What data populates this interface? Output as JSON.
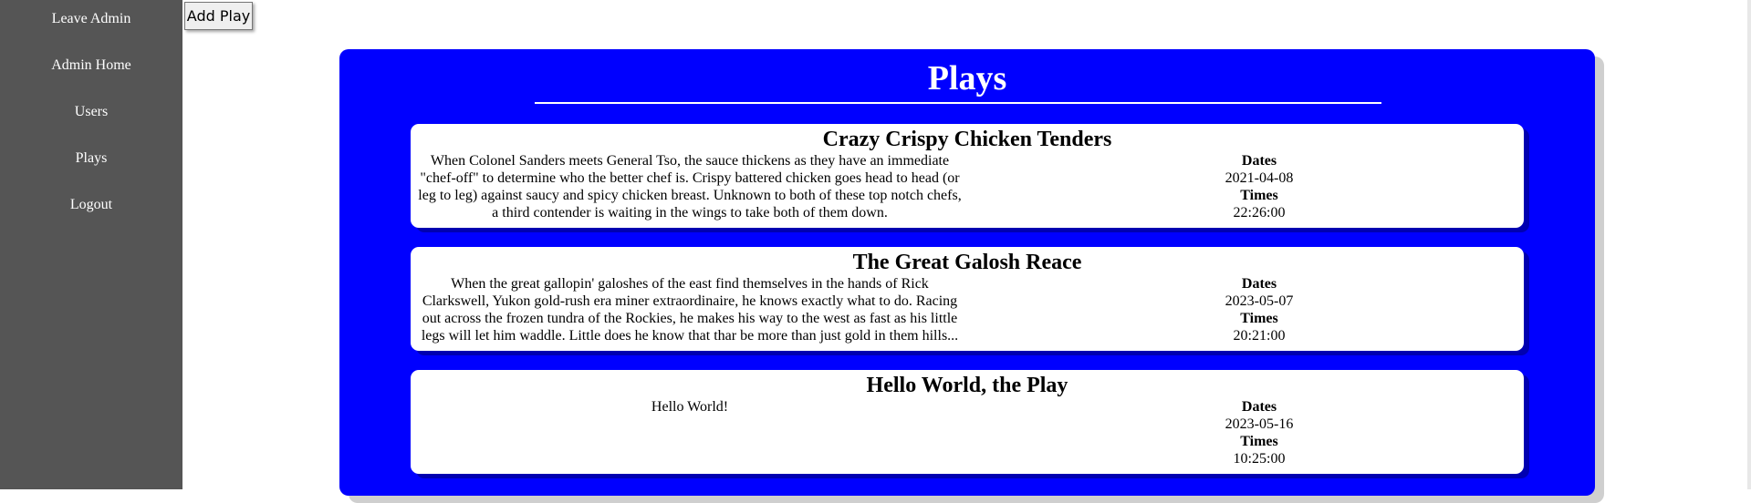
{
  "sidebar": {
    "items": [
      {
        "label": "Leave Admin"
      },
      {
        "label": "Admin Home"
      },
      {
        "label": "Users"
      },
      {
        "label": "Plays"
      },
      {
        "label": "Logout"
      }
    ]
  },
  "toolbar": {
    "add_play_label": "Add Play"
  },
  "main": {
    "title": "Plays",
    "dates_label": "Dates",
    "times_label": "Times",
    "plays": [
      {
        "title": "Crazy Crispy Chicken Tenders",
        "description": "When Colonel Sanders meets General Tso, the sauce thickens as they have an immediate \"chef-off\" to determine who the better chef is. Crispy battered chicken goes head to head (or leg to leg) against saucy and spicy chicken breast. Unknown to both of these top notch chefs, a third contender is waiting in the wings to take both of them down.",
        "date": "2021-04-08",
        "time": "22:26:00"
      },
      {
        "title": "The Great Galosh Reace",
        "description": "When the great gallopin' galoshes of the east find themselves in the hands of Rick Clarkswell, Yukon gold-rush era miner extraordinaire, he knows exactly what to do. Racing out across the frozen tundra of the Rockies, he makes his way to the west as fast as his little legs will let him waddle. Little does he know that thar be more than just gold in them hills...",
        "date": "2023-05-07",
        "time": "20:21:00"
      },
      {
        "title": "Hello World, the Play",
        "description": "Hello World!",
        "date": "2023-05-16",
        "time": "10:25:00"
      }
    ]
  },
  "colors": {
    "sidebar_bg": "#555555",
    "panel_bg": "#0000ff",
    "card_bg": "#ffffff"
  }
}
